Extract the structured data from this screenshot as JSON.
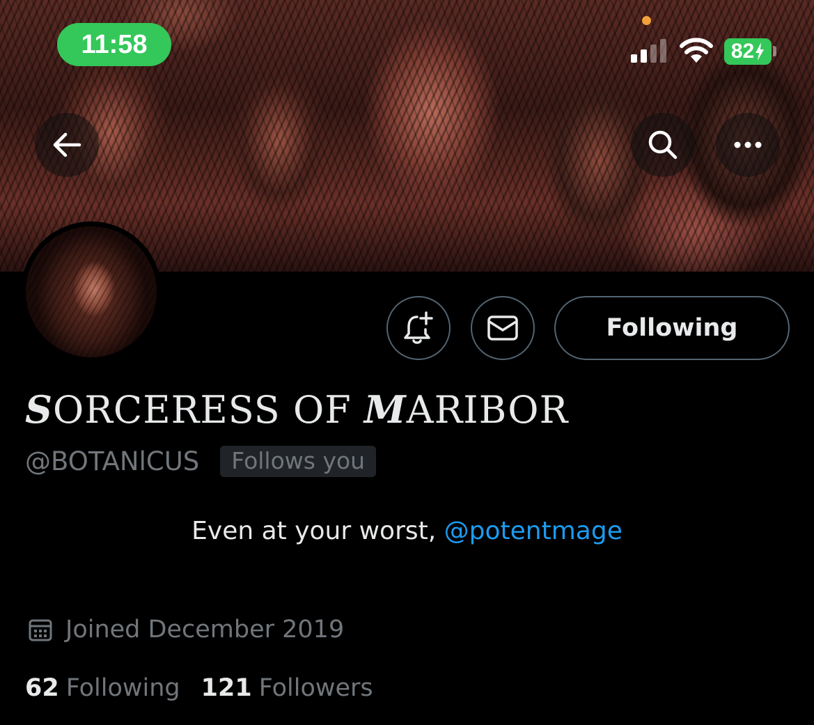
{
  "status_bar": {
    "time": "11:58",
    "battery": "82",
    "battery_color": "#34c759"
  },
  "banner": {
    "back_icon": "arrow-left-icon",
    "search_icon": "search-icon",
    "more_icon": "more-horizontal-icon"
  },
  "actions": {
    "notify_icon": "bell-plus-icon",
    "message_icon": "envelope-icon",
    "following_label": "Following"
  },
  "profile": {
    "display_name_s": "S",
    "display_name_rest1": "ORCERESS OF ",
    "display_name_m": "M",
    "display_name_rest2": "ARIBOR",
    "handle": "@BOTANlCUS",
    "follows_you": "Follows you",
    "bio_text": "Even at your worst, ",
    "bio_mention": "@potentmage",
    "joined": "Joined December 2019",
    "following_count": "62",
    "following_label": "Following",
    "followers_count": "121",
    "followers_label": "Followers"
  },
  "colors": {
    "background": "#000000",
    "text_primary": "#e7e9ea",
    "text_secondary": "#71767b",
    "link": "#1d9bf0",
    "border": "#536471"
  }
}
